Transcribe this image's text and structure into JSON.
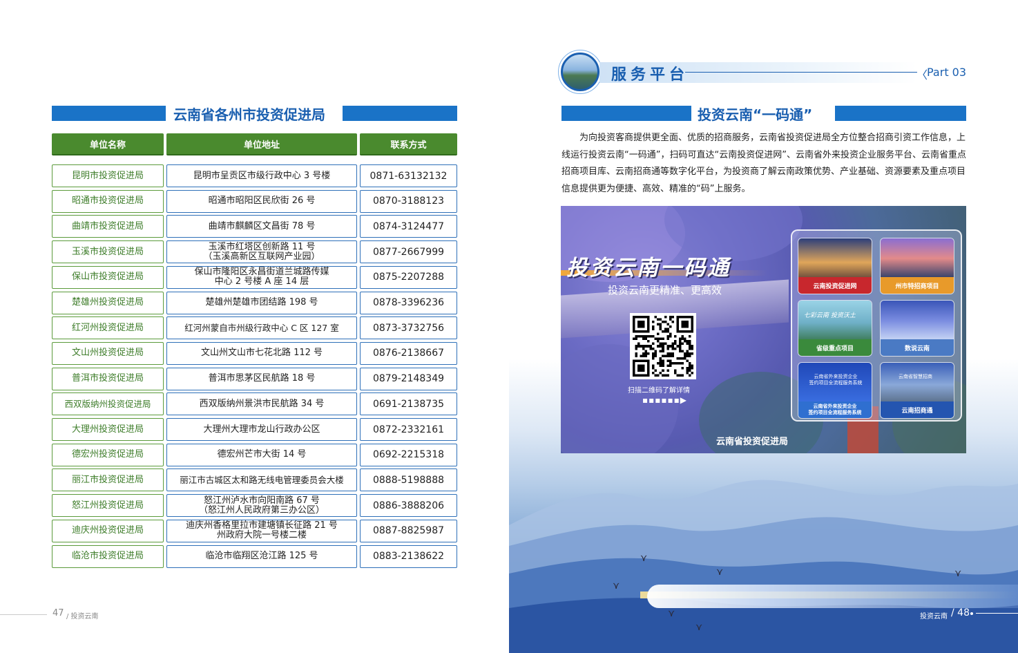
{
  "left_page": {
    "section_title": "云南省各州市投资促进局",
    "headers": [
      "单位名称",
      "单位地址",
      "联系方式"
    ],
    "rows": [
      {
        "name": "昆明市投资促进局",
        "address": "昆明市呈贡区市级行政中心 3 号楼",
        "phone": "0871-63132132"
      },
      {
        "name": "昭通市投资促进局",
        "address": "昭通市昭阳区民欣街 26 号",
        "phone": "0870-3188123"
      },
      {
        "name": "曲靖市投资促进局",
        "address": "曲靖市麒麟区文昌街 78 号",
        "phone": "0874-3124477"
      },
      {
        "name": "玉溪市投资促进局",
        "address": "玉溪市红塔区创新路 11 号\n（玉溪高新区互联网产业园）",
        "phone": "0877-2667999"
      },
      {
        "name": "保山市投资促进局",
        "address": "保山市隆阳区永昌街道兰城路传媒\n中心 2 号楼 A 座 14 层",
        "phone": "0875-2207288"
      },
      {
        "name": "楚雄州投资促进局",
        "address": "楚雄州楚雄市团结路 198 号",
        "phone": "0878-3396236"
      },
      {
        "name": "红河州投资促进局",
        "address": "红河州蒙自市州级行政中心 C 区 127 室",
        "phone": "0873-3732756"
      },
      {
        "name": "文山州投资促进局",
        "address": "文山州文山市七花北路 112 号",
        "phone": "0876-2138667"
      },
      {
        "name": "普洱市投资促进局",
        "address": "普洱市思茅区民航路 18 号",
        "phone": "0879-2148349"
      },
      {
        "name": "西双版纳州投资促进局",
        "address": "西双版纳州景洪市民航路 34 号",
        "phone": "0691-2138735"
      },
      {
        "name": "大理州投资促进局",
        "address": "大理州大理市龙山行政办公区",
        "phone": "0872-2332161"
      },
      {
        "name": "德宏州投资促进局",
        "address": "德宏州芒市大街 14 号",
        "phone": "0692-2215318"
      },
      {
        "name": "丽江市投资促进局",
        "address": "丽江市古城区太和路无线电管理委员会大楼",
        "phone": "0888-5198888"
      },
      {
        "name": "怒江州投资促进局",
        "address": "怒江州泸水市向阳南路 67 号\n（怒江州人民政府第三办公区）",
        "phone": "0886-3888206"
      },
      {
        "name": "迪庆州投资促进局",
        "address": "迪庆州香格里拉市建塘镇长征路 21 号\n州政府大院一号楼二楼",
        "phone": "0887-8825987"
      },
      {
        "name": "临沧市投资促进局",
        "address": "临沧市临翔区沧江路 125 号",
        "phone": "0883-2138622"
      }
    ],
    "footer": {
      "page_number": "47",
      "label": "/ 投资云南"
    }
  },
  "right_page": {
    "section_header": "服务平台",
    "part_label": "Part 03",
    "chevron": "〈",
    "sub_title": "投资云南“一码通”",
    "paragraph": "为向投资客商提供更全面、优质的招商服务，云南省投资促进局全方位整合招商引资工作信息，上线运行投资云南“一码通”，扫码可直达“云南投资促进网”、云南省外来投资企业服务平台、云南省重点招商项目库、云南招商通等数字化平台，为投资商了解云南政策优势、产业基础、资源要素及重点项目信息提供更为便捷、高效、精准的“码”上服务。",
    "poster": {
      "title": "投资云南一码通",
      "subtitle": "投资云南更精准、更高效",
      "qr_caption": "扫描二维码了解详情",
      "arrow": "▪▪▪▪▪▪▶",
      "org": "云南省投资促进局",
      "tiles": [
        {
          "caption": "云南投资促进网",
          "color": "#c8272d"
        },
        {
          "caption": "州市特招商项目",
          "color": "#e89a2a"
        },
        {
          "caption": "省级重点项目",
          "color": "#3a8a3c",
          "overlay": "七彩云南  投资沃土"
        },
        {
          "caption": "数说云南",
          "color": "#4a7ac4"
        },
        {
          "caption": "云南省外来投资企业\n签约项目全流程服务系统",
          "color": "#2f6fd0",
          "overlay": "云南省外来投资企业\n签约项目全流程服务系统"
        },
        {
          "caption": "云南招商通",
          "color": "#2455b0",
          "overlay": "云南省智慧招商"
        }
      ]
    },
    "footer": {
      "label": "投资云南",
      "page_number": "/ 48"
    }
  },
  "colors": {
    "brand_blue": "#1a73c7",
    "title_blue": "#1a5fb0",
    "header_green": "#4a8a2e",
    "name_green": "#3e7d2a"
  }
}
